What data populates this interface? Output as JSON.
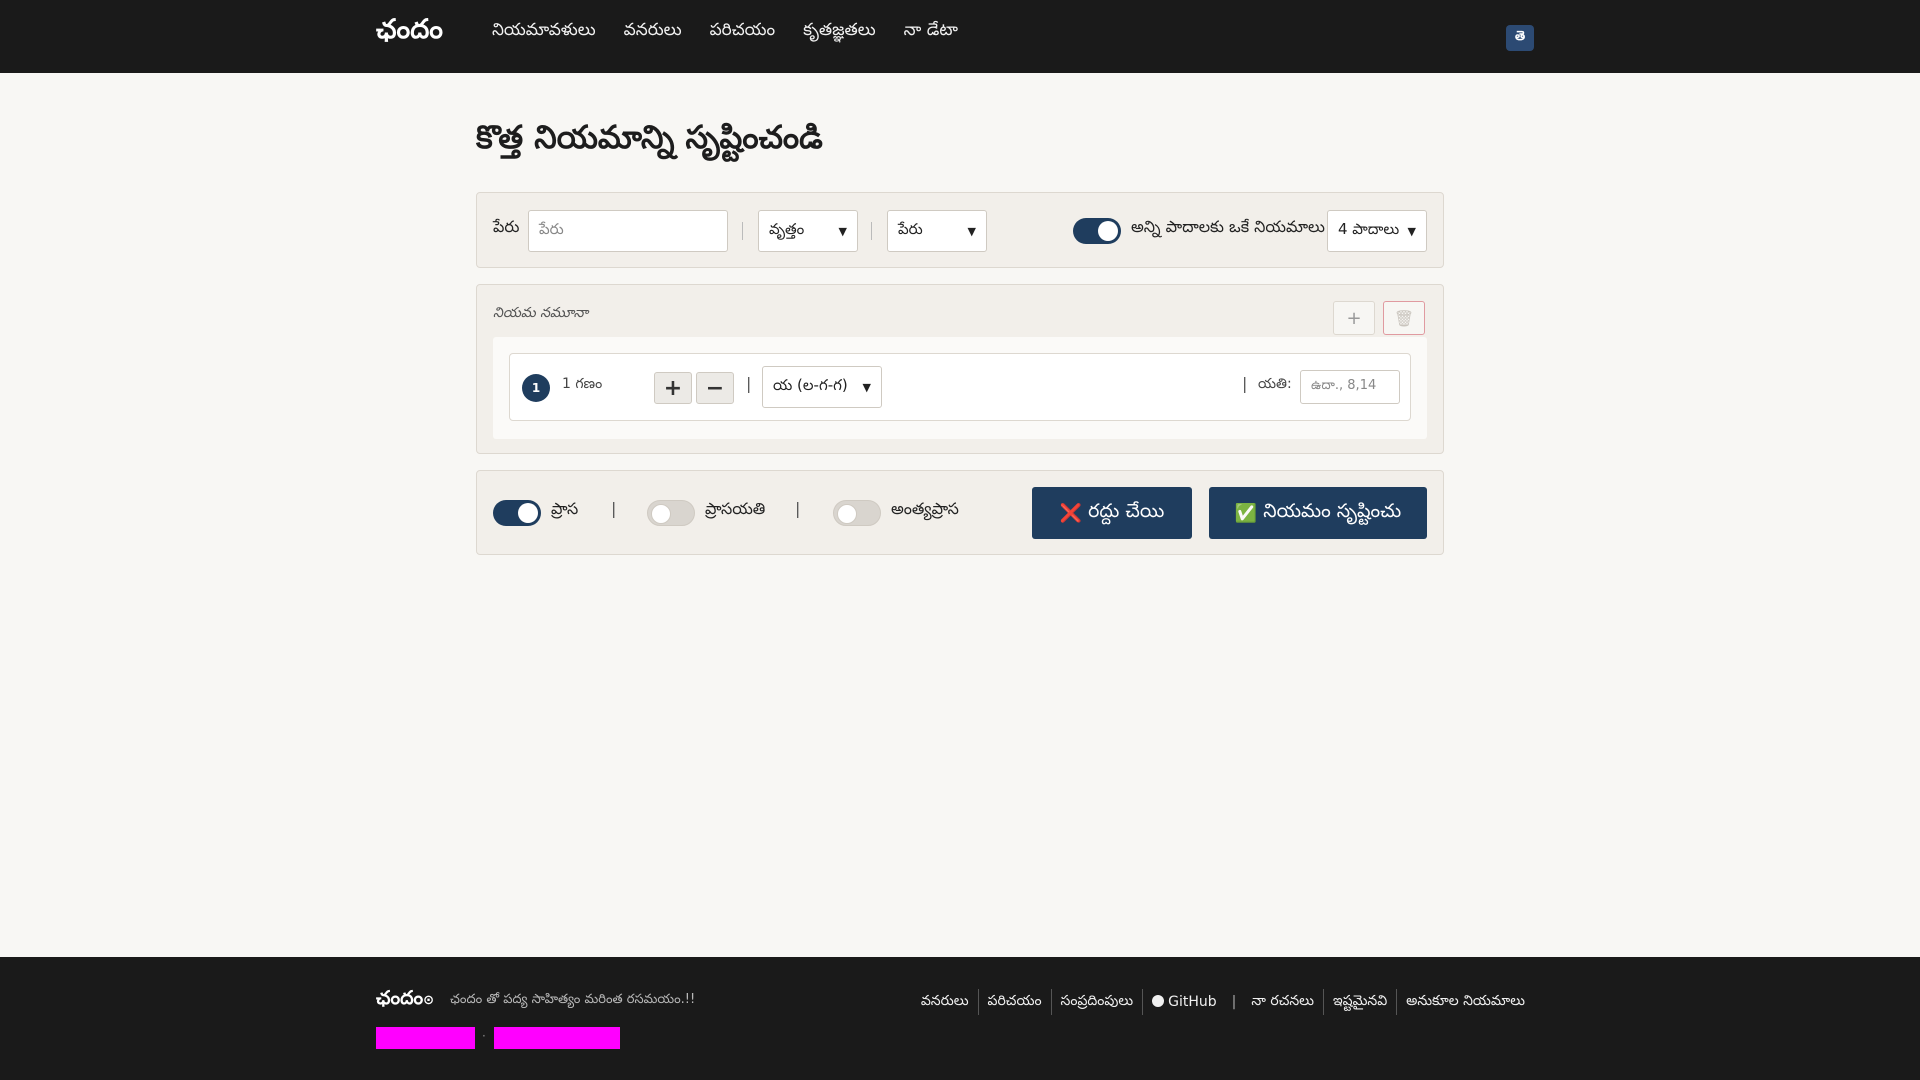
{
  "header": {
    "brand": "ఛందం",
    "nav": [
      "నియమావళులు",
      "వనరులు",
      "పరిచయం",
      "కృతజ్ఞతలు",
      "నా డేటా"
    ],
    "lang_button": "తె"
  },
  "page_title": "కొత్త నియమాన్ని సృష్టించండి",
  "form": {
    "name_label": "పేరు",
    "name_placeholder": "పేరు",
    "type_select": "వృత్తం",
    "sub_select": "పేరు",
    "same_rules_label": "అన్ని పాదాలకు ఒకే నియమాలు",
    "same_rules_on": true,
    "padas_select": "4 పాదాలు"
  },
  "template": {
    "label": "నియమ నమూనా",
    "add_icon": "plus-icon",
    "delete_icon": "trash-icon",
    "row": {
      "number": "1",
      "gana_count": "1 గణం",
      "plus": "+",
      "minus": "−",
      "gana_select": "య (ల-గ-గ)",
      "yati_label": "యతి:",
      "yati_placeholder": "ఉదా., 8,14"
    }
  },
  "options": {
    "prasa_label": "ప్రాస",
    "prasa_on": true,
    "prasayati_label": "ప్రాసయతి",
    "prasayati_on": false,
    "antyaprasa_label": "అంత్యప్రాస",
    "antyaprasa_on": false,
    "cancel_icon": "❌",
    "cancel_label": "రద్దు చేయి",
    "create_icon": "✅",
    "create_label": "నియమం సృష్టించు"
  },
  "footer": {
    "brand": "ఛందం",
    "tagline": "ఛందం తో పద్య సాహిత్యం మరింత రసమయం.!!",
    "links": [
      "వనరులు",
      "పరిచయం",
      "సంప్రదింపులు",
      "GitHub",
      "నా రచనలు",
      "ఇష్టమైనవి",
      "అనుకూల నియమాలు"
    ]
  }
}
